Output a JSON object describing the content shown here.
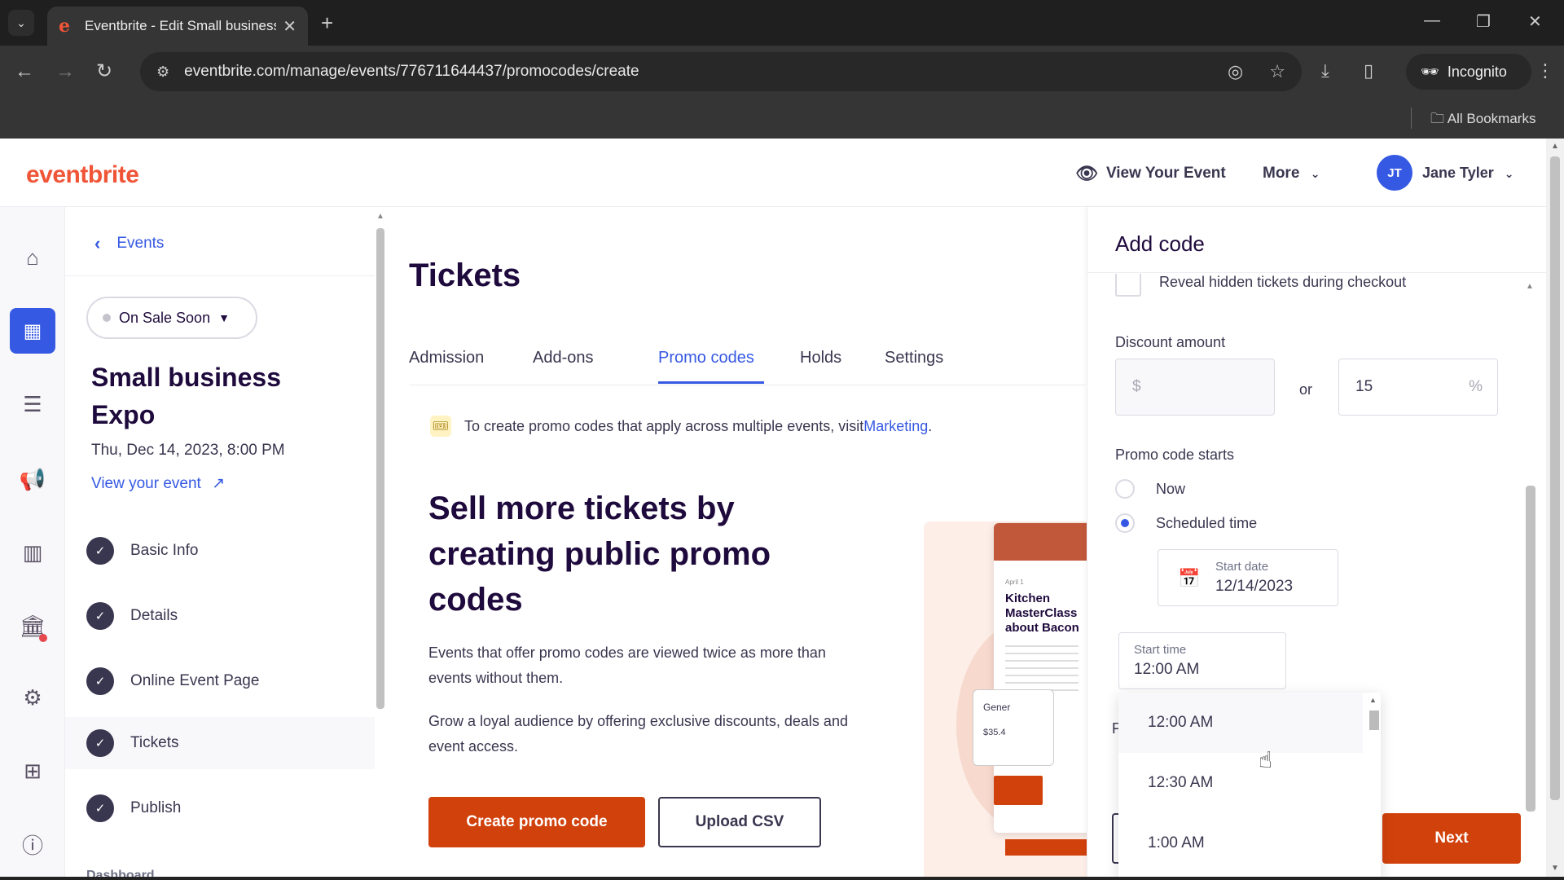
{
  "browser": {
    "tab_title": "Eventbrite - Edit Small business",
    "url": "eventbrite.com/manage/events/776711644437/promocodes/create",
    "incognito_label": "Incognito",
    "bookmarks_label": "All Bookmarks"
  },
  "header": {
    "logo": "eventbrite",
    "view_event": "View Your Event",
    "more": "More",
    "avatar_initials": "JT",
    "user_name": "Jane Tyler"
  },
  "sidebar": {
    "back_label": "Events",
    "status": "On Sale Soon",
    "event_title": "Small business Expo",
    "event_date": "Thu, Dec 14, 2023, 8:00 PM",
    "view_link": "View your event",
    "steps": [
      {
        "label": "Basic Info"
      },
      {
        "label": "Details"
      },
      {
        "label": "Online Event Page"
      },
      {
        "label": "Tickets"
      },
      {
        "label": "Publish"
      }
    ],
    "dashboard_label": "Dashboard"
  },
  "main": {
    "title": "Tickets",
    "tabs": [
      {
        "label": "Admission"
      },
      {
        "label": "Add-ons"
      },
      {
        "label": "Promo codes"
      },
      {
        "label": "Holds"
      },
      {
        "label": "Settings"
      }
    ],
    "info_text": "To create promo codes that apply across multiple events, visit ",
    "info_link": "Marketing",
    "info_end": ".",
    "heading": "Sell more tickets by creating public promo codes",
    "para1": "Events that offer promo codes are viewed twice as more than events without them.",
    "para2": "Grow a loyal audience by offering exclusive discounts, deals and event access.",
    "create_btn": "Create promo code",
    "upload_btn": "Upload CSV",
    "illustration": {
      "date": "April 1",
      "title": "Kitchen MasterClass about Bacon",
      "ticket_name": "Gener",
      "ticket_price": "$35.4"
    }
  },
  "panel": {
    "title": "Add code",
    "reveal_label": "Reveal hidden tickets during checkout",
    "discount_label": "Discount amount",
    "currency_symbol": "$",
    "or_label": "or",
    "percent_value": "15",
    "percent_symbol": "%",
    "starts_label": "Promo code starts",
    "radio_now": "Now",
    "radio_scheduled": "Scheduled time",
    "start_date_caption": "Start date",
    "start_date_value": "12/14/2023",
    "start_time_caption": "Start time",
    "start_time_value": "12:00 AM",
    "time_options": [
      "12:00 AM",
      "12:30 AM",
      "1:00 AM"
    ],
    "hidden_letter": "F",
    "next_btn": "Next"
  }
}
